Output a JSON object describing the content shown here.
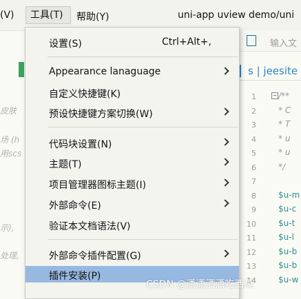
{
  "menubar": {
    "items": [
      {
        "label": "(V)"
      },
      {
        "label": "工具(T)"
      },
      {
        "label": "帮助(Y)"
      }
    ],
    "window_title": "uni-app uview demo/uni"
  },
  "editor": {
    "toolbar_placeholder": "输入文",
    "tab_label": "s | jeesite",
    "left_snippets": [
      "皮肤",
      "场 (h",
      "用scs",
      "示),",
      "处理,"
    ],
    "line_numbers": [
      "1",
      "2",
      "3",
      "4",
      "5",
      "6",
      "7",
      "8",
      "9",
      "10",
      "11",
      "12",
      "13",
      "14"
    ],
    "code_lines": [
      "/**",
      "* C",
      "* T",
      "* u",
      "* u",
      "*/",
      "",
      "$u-m",
      "$u-c",
      "$u-t",
      "$u-l",
      "$u-b",
      "$u-b",
      "$u-w"
    ]
  },
  "dropdown": {
    "items": [
      {
        "label": "设置(S)",
        "shortcut": "Ctrl+Alt+,",
        "submenu": false
      },
      {
        "label": "Appearance lanaguage",
        "shortcut": "",
        "submenu": true
      },
      {
        "label": "自定义快捷键(K)",
        "shortcut": "",
        "submenu": false
      },
      {
        "label": "预设快捷键方案切换(W)",
        "shortcut": "",
        "submenu": true
      },
      {
        "label": "代码块设置(N)",
        "shortcut": "",
        "submenu": true
      },
      {
        "label": "主题(T)",
        "shortcut": "",
        "submenu": true
      },
      {
        "label": "项目管理器图标主题(I)",
        "shortcut": "",
        "submenu": true
      },
      {
        "label": "外部命令(E)",
        "shortcut": "",
        "submenu": true
      },
      {
        "label": "验证本文档语法(V)",
        "shortcut": "",
        "submenu": false
      },
      {
        "label": "外部命令插件配置(G)",
        "shortcut": "",
        "submenu": true
      },
      {
        "label": "插件安装(P)",
        "shortcut": "",
        "submenu": false,
        "selected": true
      }
    ]
  },
  "watermark": "CSDN @潇潇洒洒吃西瓜",
  "colors": {
    "selection": "#97b9e1",
    "menu_bg": "#f4f4ef",
    "accent_blue": "#2c84c7",
    "green_marker": "#3aa35c"
  }
}
